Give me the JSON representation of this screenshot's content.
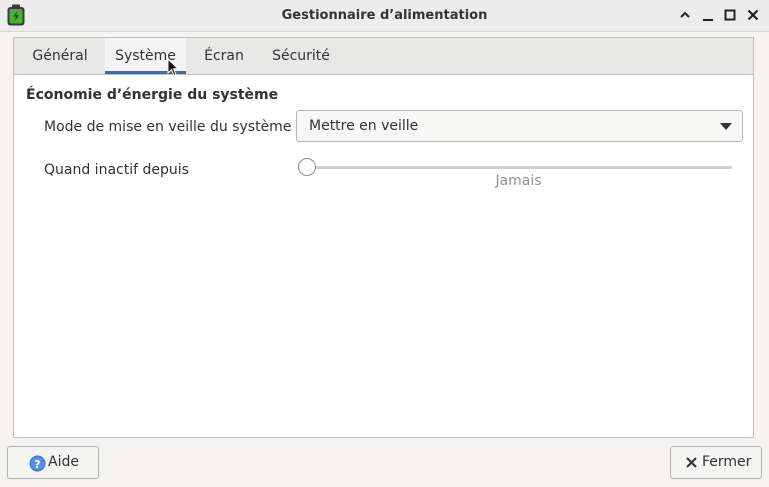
{
  "window": {
    "title": "Gestionnaire d’alimentation",
    "controls": [
      "minimize-icon",
      "maximize-icon",
      "close-icon"
    ]
  },
  "tabs": [
    {
      "label": "Général",
      "selected": false
    },
    {
      "label": "Système",
      "selected": true
    },
    {
      "label": "Écran",
      "selected": false
    },
    {
      "label": "Sécurité",
      "selected": false
    }
  ],
  "section": {
    "title": "Économie d’énergie du système",
    "sleep_mode_label": "Mode de mise en veille du système :",
    "sleep_mode_value": "Mettre en veille",
    "inactive_label": "Quand inactif depuis",
    "inactive_slider_value_text": "Jamais",
    "inactive_slider_level": 0
  },
  "buttons": {
    "help": {
      "label": "Aide",
      "icon": "help-icon"
    },
    "close": {
      "label": "Fermer",
      "icon": "close-x-icon"
    }
  },
  "colors": {
    "accent": "#2c6fbf",
    "battery_green": "#4caf3a"
  }
}
